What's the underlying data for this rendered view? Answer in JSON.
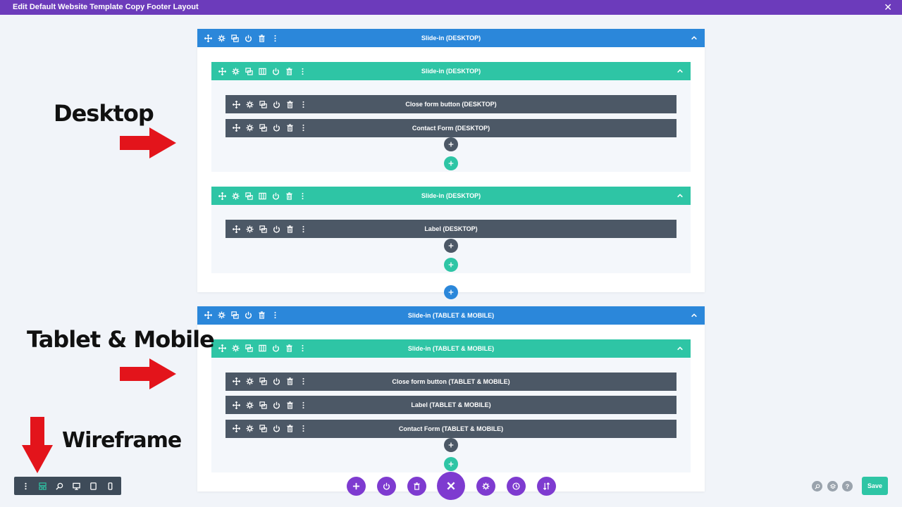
{
  "window": {
    "title": "Edit Default Website Template Copy Footer Layout",
    "close_symbol": "✕"
  },
  "annotations": {
    "desktop": "Desktop",
    "tablet_mobile": "Tablet & Mobile",
    "wireframe": "Wireframe",
    "arrow_color": "#e3141b"
  },
  "colors": {
    "section": "#2b87da",
    "row": "#2ec5a5",
    "module": "#4c5866",
    "purple": "#7e3bd0",
    "topbar": "#6c3bbb"
  },
  "sections": [
    {
      "label": "Slide-in (DESKTOP)",
      "rows": [
        {
          "label": "Slide-in (DESKTOP)",
          "modules": [
            "Close form button (DESKTOP)",
            "Contact Form (DESKTOP)"
          ]
        },
        {
          "label": "Slide-in (DESKTOP)",
          "modules": [
            "Label (DESKTOP)"
          ]
        }
      ]
    },
    {
      "label": "Slide-in (TABLET & MOBILE)",
      "rows": [
        {
          "label": "Slide-in (TABLET & MOBILE)",
          "modules": [
            "Close form button (TABLET & MOBILE)",
            "Label (TABLET & MOBILE)",
            "Contact Form (TABLET & MOBILE)"
          ]
        }
      ]
    }
  ],
  "bar_icons": {
    "section": [
      "move-icon",
      "gear-icon",
      "duplicate-icon",
      "power-icon",
      "trash-icon",
      "more-icon"
    ],
    "row": [
      "move-icon",
      "gear-icon",
      "duplicate-icon",
      "columns-icon",
      "power-icon",
      "trash-icon",
      "more-icon"
    ],
    "module": [
      "move-icon",
      "gear-icon",
      "duplicate-icon",
      "power-icon",
      "trash-icon",
      "more-icon"
    ]
  },
  "wireframe_toolbar": [
    "more-icon",
    "wireframe-icon",
    "zoom-icon",
    "desktop-icon",
    "tablet-icon",
    "phone-icon"
  ],
  "bottom_toolbar": [
    "add-icon",
    "power-icon",
    "trash-icon",
    "close-icon",
    "gear-icon",
    "history-icon",
    "sort-icon"
  ],
  "right_toolbar": [
    "search-icon",
    "layers-icon",
    "help-icon"
  ],
  "save_label": "Save",
  "help_symbol": "?"
}
